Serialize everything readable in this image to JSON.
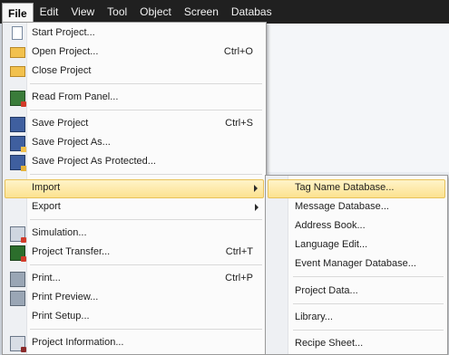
{
  "menubar": {
    "items": [
      {
        "label": "File"
      },
      {
        "label": "Edit"
      },
      {
        "label": "View"
      },
      {
        "label": "Tool"
      },
      {
        "label": "Object"
      },
      {
        "label": "Screen"
      },
      {
        "label": "Databas"
      }
    ]
  },
  "file_menu": {
    "items": [
      {
        "label": "Start Project...",
        "icon": "new-document-icon",
        "shortcut": ""
      },
      {
        "label": "Open Project...",
        "icon": "open-folder-icon",
        "shortcut": "Ctrl+O"
      },
      {
        "label": "Close Project",
        "icon": "close-folder-icon",
        "shortcut": ""
      },
      {
        "label": "Read From Panel...",
        "icon": "panel-read-icon",
        "shortcut": ""
      },
      {
        "label": "Save Project",
        "icon": "floppy-disk-icon",
        "shortcut": "Ctrl+S"
      },
      {
        "label": "Save Project As...",
        "icon": "save-as-icon",
        "shortcut": ""
      },
      {
        "label": "Save Project As Protected...",
        "icon": "save-protected-icon",
        "shortcut": ""
      },
      {
        "label": "Import",
        "icon": "",
        "shortcut": ""
      },
      {
        "label": "Export",
        "icon": "",
        "shortcut": ""
      },
      {
        "label": "Simulation...",
        "icon": "simulation-icon",
        "shortcut": ""
      },
      {
        "label": "Project Transfer...",
        "icon": "transfer-icon",
        "shortcut": "Ctrl+T"
      },
      {
        "label": "Print...",
        "icon": "printer-icon",
        "shortcut": "Ctrl+P"
      },
      {
        "label": "Print Preview...",
        "icon": "print-preview-icon",
        "shortcut": ""
      },
      {
        "label": "Print Setup...",
        "icon": "",
        "shortcut": ""
      },
      {
        "label": "Project Information...",
        "icon": "project-info-icon",
        "shortcut": ""
      }
    ]
  },
  "import_submenu": {
    "items": [
      {
        "label": "Tag Name Database..."
      },
      {
        "label": "Message Database..."
      },
      {
        "label": "Address Book..."
      },
      {
        "label": "Language Edit..."
      },
      {
        "label": "Event Manager Database..."
      },
      {
        "label": "Project Data..."
      },
      {
        "label": "Library..."
      },
      {
        "label": "Recipe Sheet..."
      }
    ]
  }
}
